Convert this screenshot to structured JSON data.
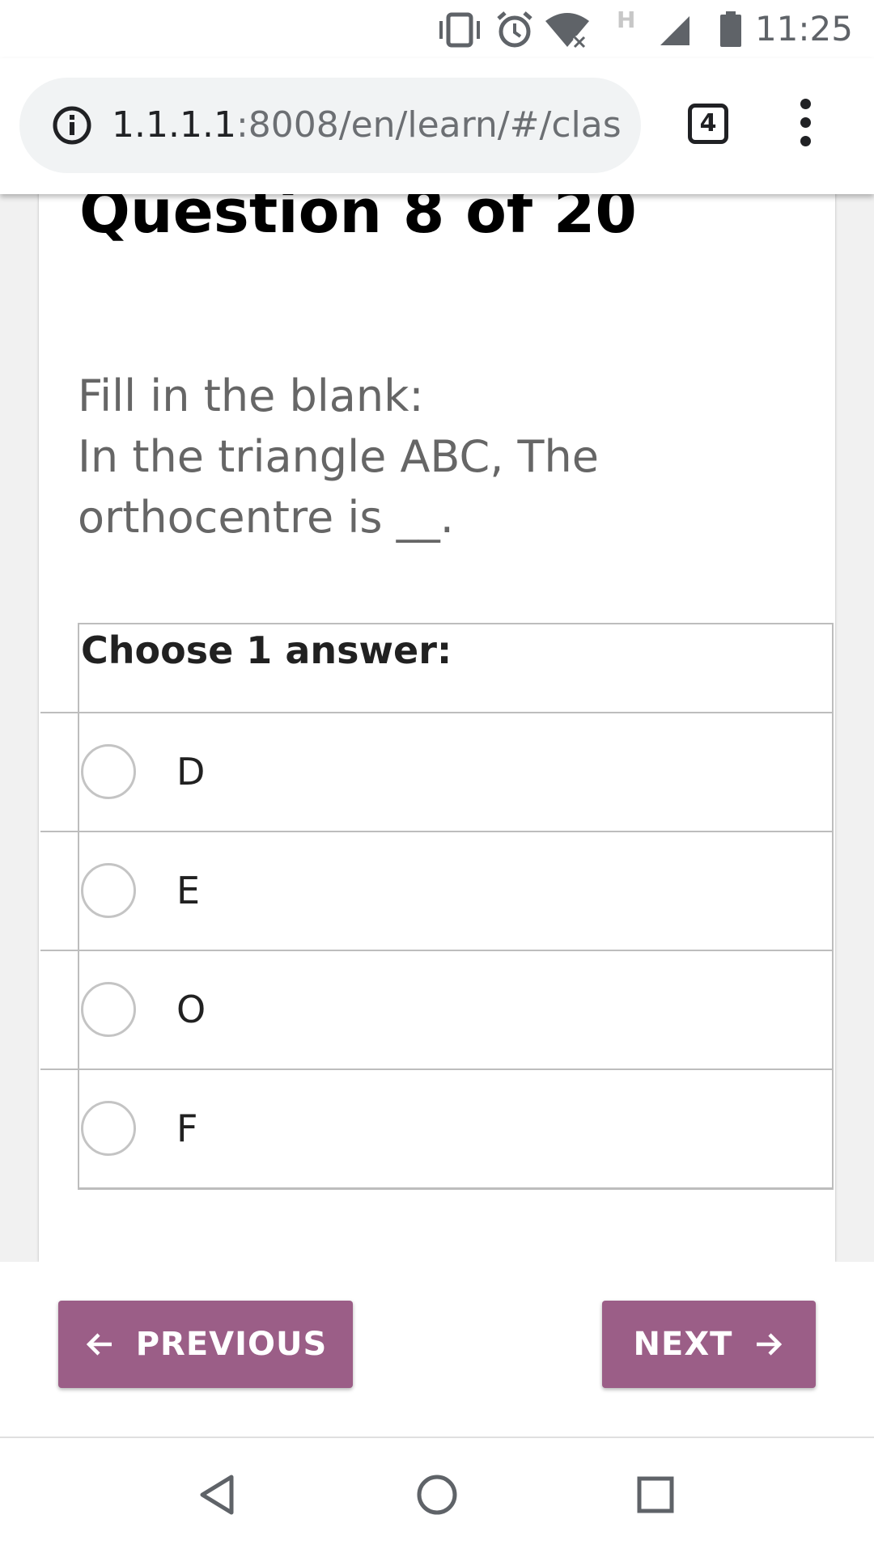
{
  "status_bar": {
    "time": "11:25",
    "icons": [
      "vibrate-icon",
      "alarm-icon",
      "wifi-off-icon",
      "h-network-icon",
      "signal-icon",
      "battery-icon"
    ],
    "network_type": "H"
  },
  "browser": {
    "url_host": "1.1.1.1",
    "url_path": ":8008/en/learn/#/clas",
    "tab_count": "4"
  },
  "quiz": {
    "title": "Question 8 of 20",
    "prompt_line1": "Fill in the blank:",
    "prompt_line2": "In the triangle ABC, The orthocentre is __.",
    "choose_label": "Choose 1 answer:",
    "options": [
      "D",
      "E",
      "O",
      "F"
    ]
  },
  "navigation": {
    "previous_label": "PREVIOUS",
    "next_label": "NEXT"
  },
  "colors": {
    "accent": "#9b5e87",
    "page_bg": "#f1f1f1",
    "border": "#bdbdbd"
  }
}
